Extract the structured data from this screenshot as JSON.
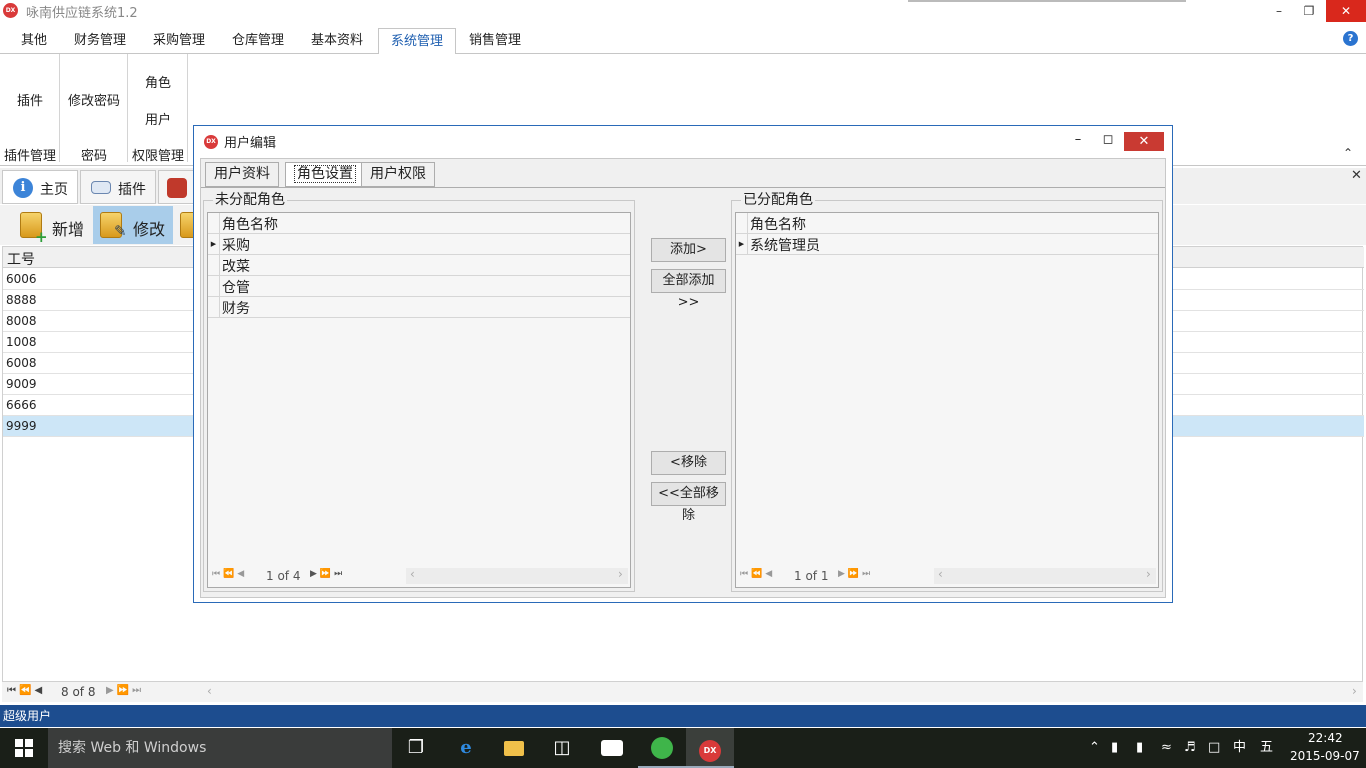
{
  "app": {
    "title": "咏南供应链系统1.2",
    "logo": "DX"
  },
  "ribbon": {
    "tabs": [
      "其他",
      "财务管理",
      "采购管理",
      "仓库管理",
      "基本资料",
      "系统管理",
      "销售管理"
    ],
    "active_tab": "系统管理",
    "groups": {
      "plugin": {
        "button": "插件",
        "label": "插件管理"
      },
      "password": {
        "button": "修改密码",
        "label": "密码"
      },
      "permission": {
        "buttons": [
          "角色",
          "用户"
        ],
        "label": "权限管理"
      }
    }
  },
  "doc_tabs": [
    "主页",
    "插件"
  ],
  "toolbar": {
    "add": "新增",
    "edit": "修改"
  },
  "grid": {
    "header": "工号",
    "rows": [
      "6006",
      "8888",
      "8008",
      "1008",
      "6008",
      "9009",
      "6666",
      "9999"
    ],
    "selected": "9999",
    "pager": "8 of 8"
  },
  "status": "超级用户",
  "dialog": {
    "title": "用户编辑",
    "logo": "DX",
    "tabs": [
      "用户资料",
      "角色设置",
      "用户权限"
    ],
    "active_tab": "角色设置",
    "left": {
      "title": "未分配角色",
      "column": "角色名称",
      "rows": [
        "采购",
        "改菜",
        "仓管",
        "财务"
      ],
      "pager": "1 of 4"
    },
    "right": {
      "title": "已分配角色",
      "column": "角色名称",
      "rows": [
        "系统管理员"
      ],
      "pager": "1 of 1"
    },
    "buttons": {
      "add": "添加>",
      "add_all": "全部添加>>",
      "remove": "<移除",
      "remove_all": "<<全部移除"
    }
  },
  "taskbar": {
    "search": "搜索 Web 和 Windows",
    "ime": "中",
    "ime2": "五",
    "time": "22:42",
    "date": "2015-09-07"
  },
  "colors": {
    "accent": "#1f5fb0",
    "status_bar": "#1d4d8f",
    "close_red": "#d9281c",
    "selection": "#cde6f7"
  }
}
